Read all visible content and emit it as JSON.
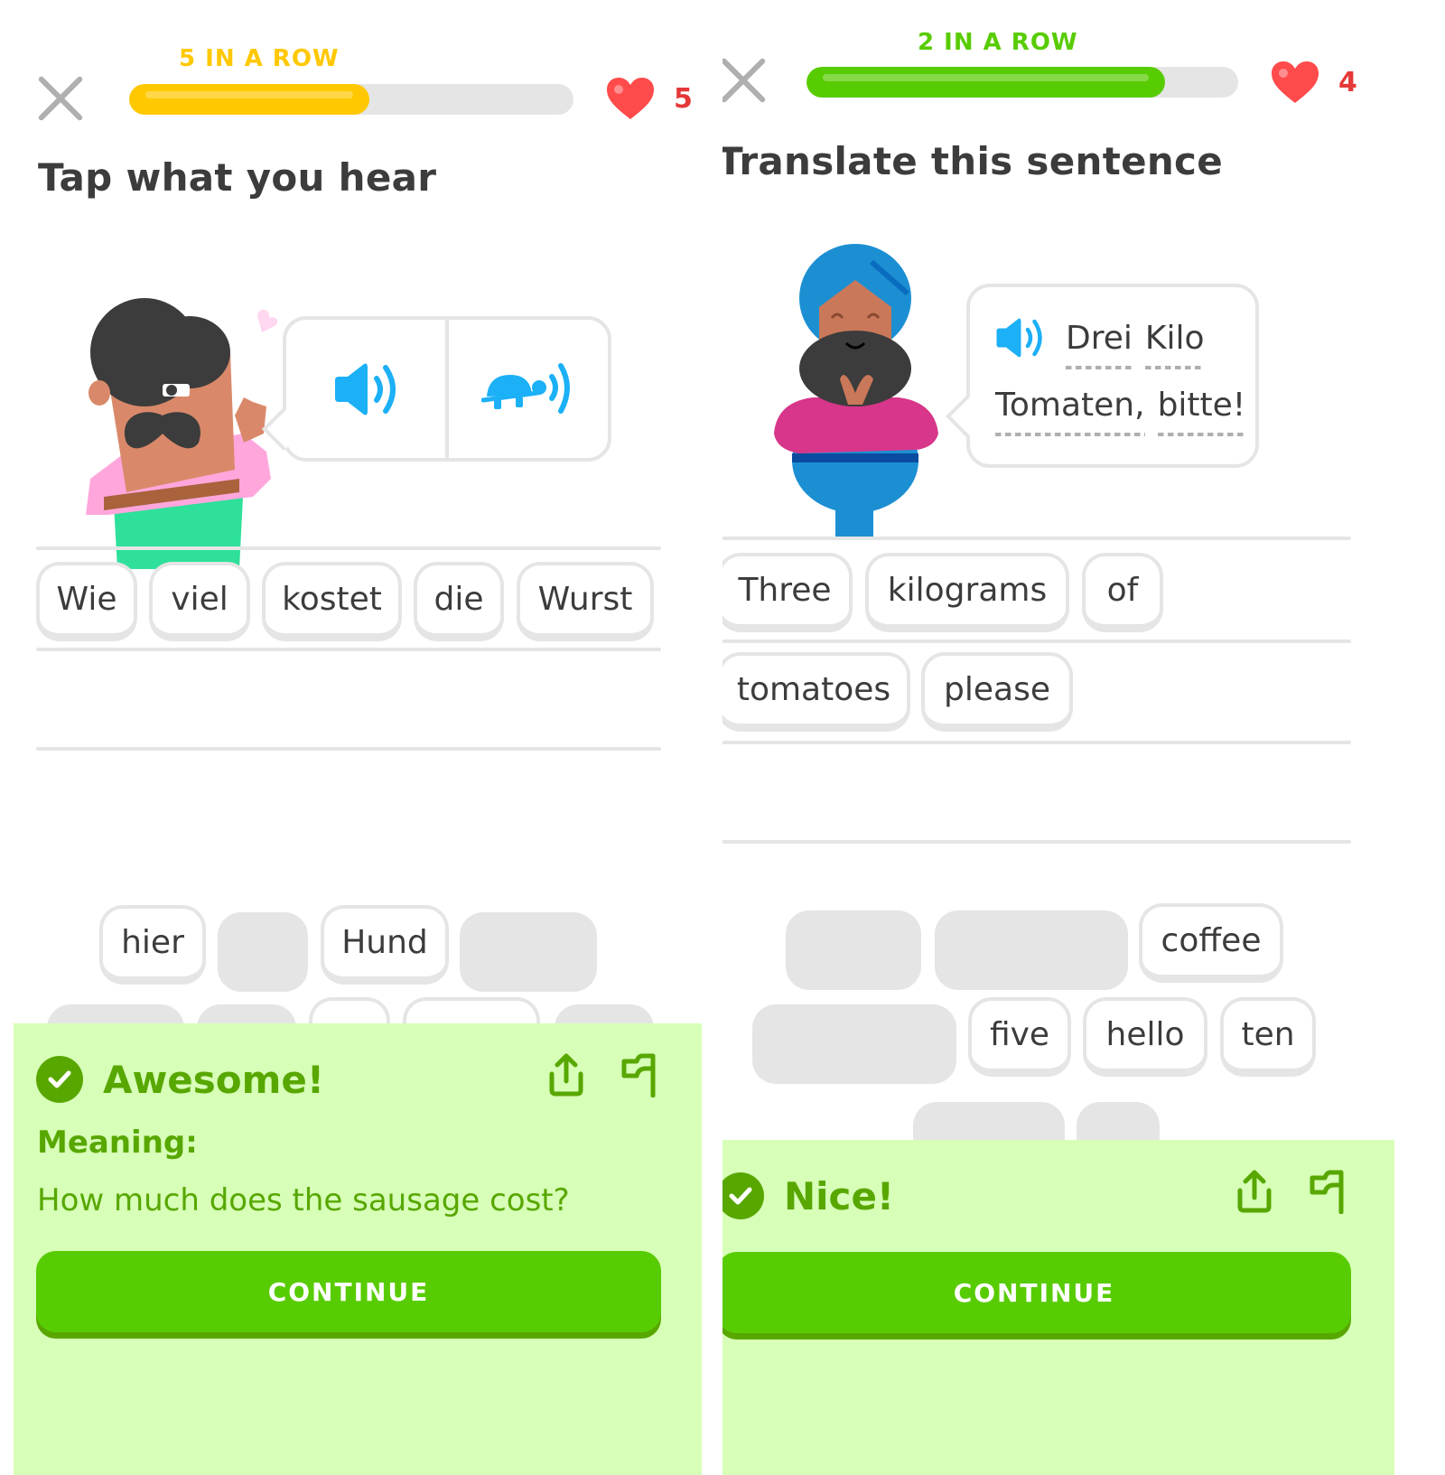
{
  "left": {
    "streak_label": "5 IN A ROW",
    "streak_color": "#ffc800",
    "progress_fraction": 0.54,
    "progress_color": "#ffc800",
    "hearts_count": "5",
    "title": "Tap what you hear",
    "audio": {
      "normal_icon": "speaker-icon",
      "slow_icon": "turtle-speaker-icon"
    },
    "answer_tiles": [
      "Wie",
      "viel",
      "kostet",
      "die",
      "Wurst"
    ],
    "bank_tiles_row1": [
      {
        "label": "hier",
        "state": "available"
      },
      {
        "label": "",
        "state": "used"
      },
      {
        "label": "Hund",
        "state": "available"
      },
      {
        "label": "",
        "state": "used"
      }
    ],
    "feedback": {
      "title": "Awesome!",
      "meaning_label": "Meaning:",
      "meaning_text": "How much does the sausage cost?",
      "continue_label": "CONTINUE"
    }
  },
  "right": {
    "streak_label": "2 IN A ROW",
    "streak_color": "#58cc02",
    "progress_fraction": 0.83,
    "progress_color": "#58cc02",
    "hearts_count": "4",
    "title": "Translate this sentence",
    "prompt": {
      "line1": [
        "Drei",
        "Kilo"
      ],
      "line2": [
        "Tomaten,",
        "bitte!"
      ]
    },
    "answer_tiles_row1": [
      "Three",
      "kilograms",
      "of"
    ],
    "answer_tiles_row2": [
      "tomatoes",
      "please"
    ],
    "bank_tiles_row1": [
      {
        "label": "",
        "state": "used"
      },
      {
        "label": "",
        "state": "used"
      },
      {
        "label": "coffee",
        "state": "available"
      }
    ],
    "bank_tiles_row2": [
      {
        "label": "",
        "state": "used"
      },
      {
        "label": "five",
        "state": "available"
      },
      {
        "label": "hello",
        "state": "available"
      },
      {
        "label": "ten",
        "state": "available"
      }
    ],
    "feedback": {
      "title": "Nice!",
      "continue_label": "CONTINUE"
    }
  },
  "colors": {
    "heart": "#ff4b4b",
    "audio_blue": "#1cb0f6",
    "success_bg": "#d7ffb8",
    "success_text": "#58a700",
    "button_green": "#58cc02"
  }
}
